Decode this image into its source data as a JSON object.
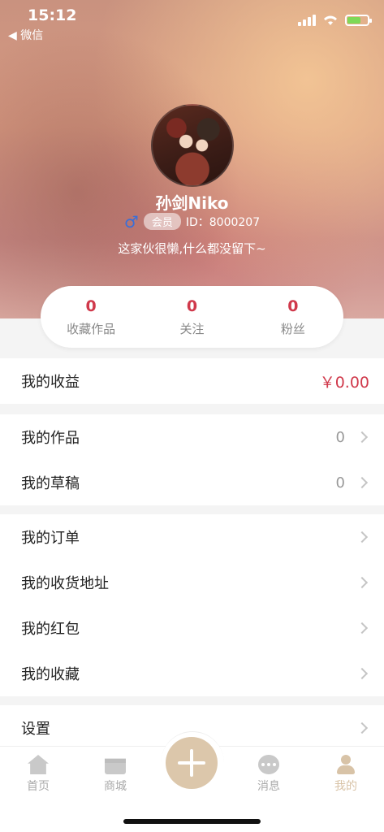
{
  "status_bar": {
    "time": "15:12",
    "back_label": "◀ 微信"
  },
  "profile": {
    "name": "孙剑Niko",
    "gender_symbol": "♂",
    "member_badge": "会员",
    "id_text": "ID：8000207",
    "bio": "这家伙很懒,什么都没留下~"
  },
  "stats": [
    {
      "value": "0",
      "label": "收藏作品"
    },
    {
      "value": "0",
      "label": "关注"
    },
    {
      "value": "0",
      "label": "粉丝"
    }
  ],
  "earnings": {
    "label": "我的收益",
    "amount": "￥0.00"
  },
  "works": [
    {
      "label": "我的作品",
      "count": "0"
    },
    {
      "label": "我的草稿",
      "count": "0"
    }
  ],
  "menu": [
    {
      "label": "我的订单"
    },
    {
      "label": "我的收货地址"
    },
    {
      "label": "我的红包"
    },
    {
      "label": "我的收藏"
    }
  ],
  "settings": {
    "label": "设置"
  },
  "tabbar": {
    "items": [
      {
        "label": "首页",
        "icon": "home-icon"
      },
      {
        "label": "商城",
        "icon": "shop-icon"
      },
      {
        "label": "消息",
        "icon": "message-icon"
      },
      {
        "label": "我的",
        "icon": "user-icon"
      }
    ],
    "active_index": 3,
    "center_icon": "plus-icon"
  },
  "colors": {
    "accent_red": "#d0394b",
    "tab_active": "#d8c3a7",
    "plus_button": "#dcc7ab"
  }
}
